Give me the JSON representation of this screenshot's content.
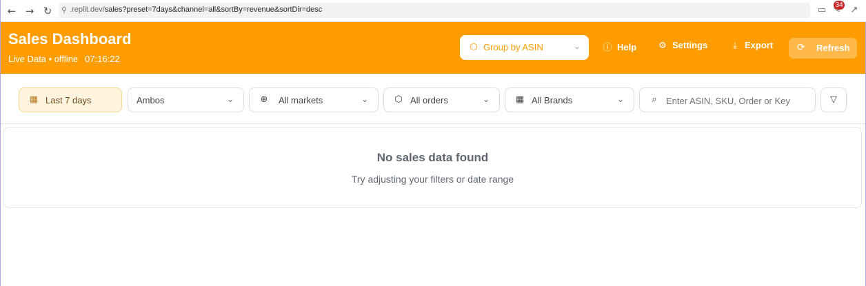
{
  "browser": {
    "url_prefix": ".replit.dev/",
    "url_path": "sales?preset=7days&channel=all&sortBy=revenue&sortDir=desc",
    "extension_badge": "34"
  },
  "header": {
    "title": "Sales Dashboard",
    "status": "Live Data • offline",
    "time": "07:16:22",
    "group_by": "Group by ASIN",
    "help": "Help",
    "settings": "Settings",
    "export": "Export",
    "refresh": "Refresh"
  },
  "filters": {
    "date_range": "Last 7 days",
    "account": "Ambos",
    "markets": "All markets",
    "orders": "All orders",
    "brands": "All Brands",
    "search_placeholder": "Enter ASIN, SKU, Order or Keyword"
  },
  "empty_state": {
    "title": "No sales data found",
    "subtitle": "Try adjusting your filters or date range"
  },
  "colors": {
    "brand": "#ff9d00",
    "date_chip_bg": "#fff4e0"
  }
}
